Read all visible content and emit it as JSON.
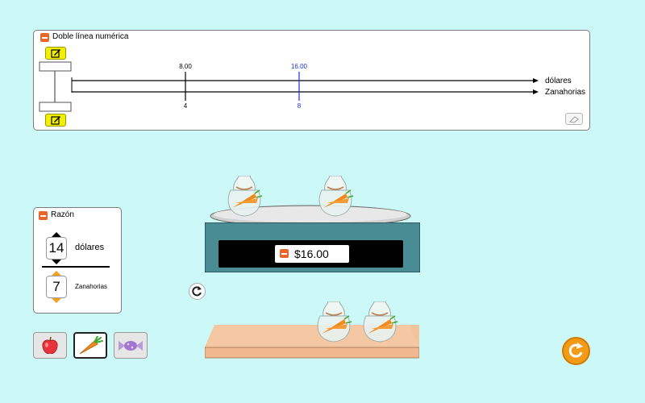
{
  "number_line": {
    "title": "Doble línea numérica",
    "top_axis_label": "dólares",
    "bottom_axis_label": "Zanahorias",
    "ticks": [
      {
        "top": "8.00",
        "bottom": "4",
        "color": "#000000"
      },
      {
        "top": "16.00",
        "bottom": "8",
        "color": "#1f2fe0"
      }
    ]
  },
  "ratio": {
    "title": "Razón",
    "top_value": "14",
    "top_unit": "dólares",
    "bottom_value": "7",
    "bottom_unit": "Zanahorias"
  },
  "scale": {
    "price": "$16.00"
  },
  "items": [
    {
      "name": "apple",
      "selected": false
    },
    {
      "name": "carrot",
      "selected": true
    },
    {
      "name": "candy",
      "selected": false
    }
  ],
  "colors": {
    "background": "#ccf9f7",
    "accent_orange": "#e8662a",
    "scale_body": "#4a8c94",
    "highlight_blue": "#1f2fe0"
  }
}
